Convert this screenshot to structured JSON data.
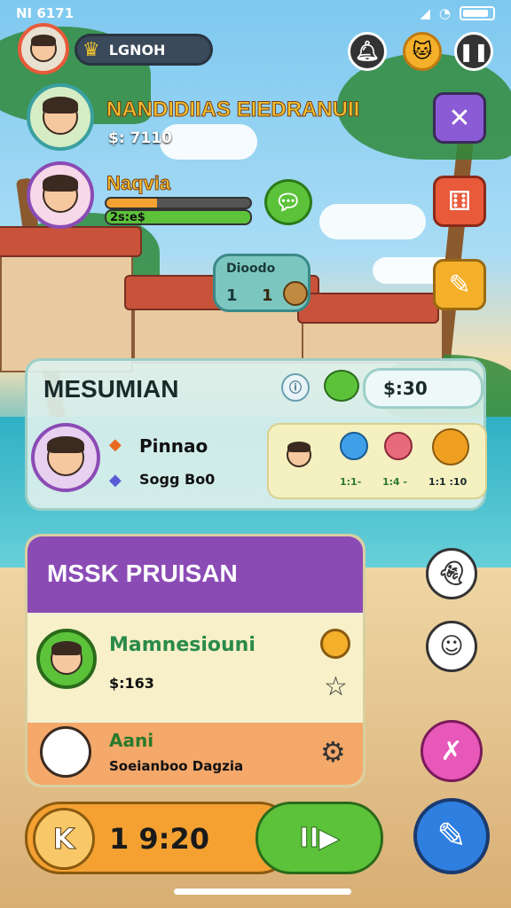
{
  "status_bar": {
    "time": "NI 6171"
  },
  "top_bar": {
    "player_name": "LGNOH"
  },
  "player_card_1": {
    "name": "NANDIDIIAS EIEDRANUII",
    "currency": "$: 7110"
  },
  "player_card_2": {
    "name": "Naqvia",
    "bar_value": "2s:e$",
    "bar_fill": 0.35
  },
  "mini_card": {
    "title": "Dioodo",
    "left_value": "1",
    "right_value": "1"
  },
  "mission_panel": {
    "title": "MESUMIAN",
    "amount": "$:30",
    "member": {
      "name": "Pinnao",
      "detail": "Sogg Bo0"
    },
    "rewards": [
      {
        "value": "1:1-",
        "color": "#3fa0e8"
      },
      {
        "value": "1:4 -",
        "color": "#e86a7a"
      },
      {
        "value": "1:1 :10",
        "color": "#f0a020"
      }
    ]
  },
  "task_panel": {
    "title": "MSSK PRUISAN",
    "item_1": {
      "name": "Mamnesiouni",
      "value": "$:163"
    },
    "item_2": {
      "name": "Aani",
      "detail": "Soeianboo Dagzia"
    }
  },
  "bottom_bar": {
    "left_button": "K",
    "timer": "1 9:20",
    "play_label": "II▶"
  },
  "colors": {
    "accent_orange": "#f4a132",
    "accent_green": "#5cc23a",
    "accent_purple": "#8b4bb5",
    "accent_blue": "#2f7fe0"
  }
}
